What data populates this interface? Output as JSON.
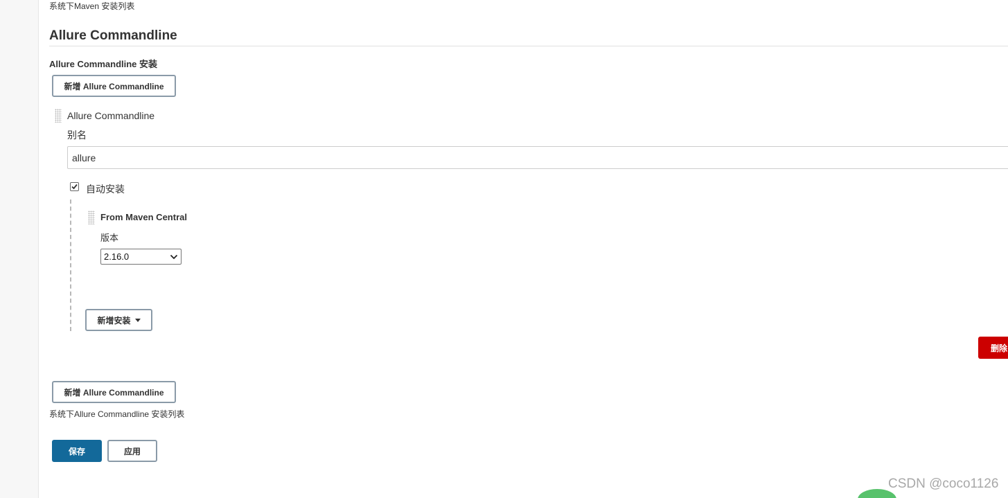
{
  "maven_section": {
    "list_description": "系统下Maven 安装列表"
  },
  "allure_section": {
    "title": "Allure Commandline",
    "installations_label": "Allure Commandline 安装",
    "add_button_label": "新增 Allure Commandline",
    "installation": {
      "type_label": "Allure Commandline",
      "alias_label": "别名",
      "alias_value": "allure",
      "auto_install_label": "自动安装",
      "auto_install_checked": true,
      "installer": {
        "title": "From Maven Central",
        "version_label": "版本",
        "version_selected": "2.16.0"
      },
      "add_installer_label": "新增安装",
      "delete_label": "删除"
    },
    "add_button_bottom_label": "新增 Allure Commandline",
    "list_description": "系统下Allure Commandline 安装列表"
  },
  "actions": {
    "save_label": "保存",
    "apply_label": "应用"
  },
  "watermark": "CSDN @coco1126",
  "colors": {
    "primary": "#13699a",
    "danger": "#cc0000",
    "border": "#8a9aa8"
  }
}
